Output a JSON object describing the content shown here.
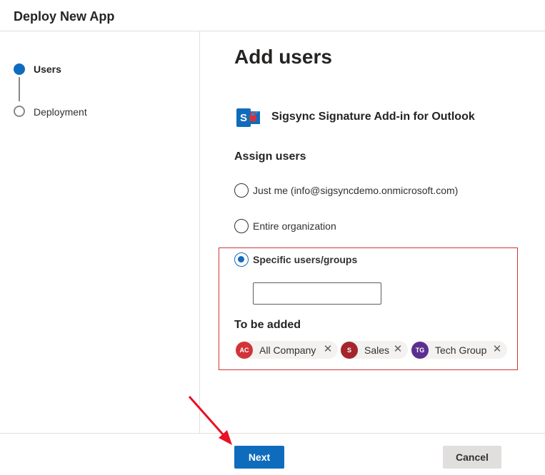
{
  "header": {
    "title": "Deploy New App"
  },
  "steps": [
    {
      "label": "Users",
      "state": "active"
    },
    {
      "label": "Deployment",
      "state": "inactive"
    }
  ],
  "main": {
    "title": "Add users",
    "app": {
      "name": "Sigsync Signature Add-in for Outlook",
      "icon": "sigsync-app-icon"
    },
    "assign_title": "Assign users",
    "options": [
      {
        "label": "Just me (info@sigsyncdemo.onmicrosoft.com)",
        "selected": false
      },
      {
        "label": "Entire organization",
        "selected": false
      },
      {
        "label": "Specific users/groups",
        "selected": true
      }
    ],
    "search": {
      "value": "",
      "placeholder": ""
    },
    "to_be_added_title": "To be added",
    "chips": [
      {
        "initials": "AC",
        "label": "All Company",
        "color": "#d13438"
      },
      {
        "initials": "S",
        "label": "Sales",
        "color": "#a4262c"
      },
      {
        "initials": "TG",
        "label": "Tech Group",
        "color": "#5c2e91"
      }
    ]
  },
  "footer": {
    "next_label": "Next",
    "cancel_label": "Cancel"
  },
  "colors": {
    "primary": "#0f6cbd",
    "highlight": "#d13438",
    "annotation_arrow": "#e81123"
  }
}
